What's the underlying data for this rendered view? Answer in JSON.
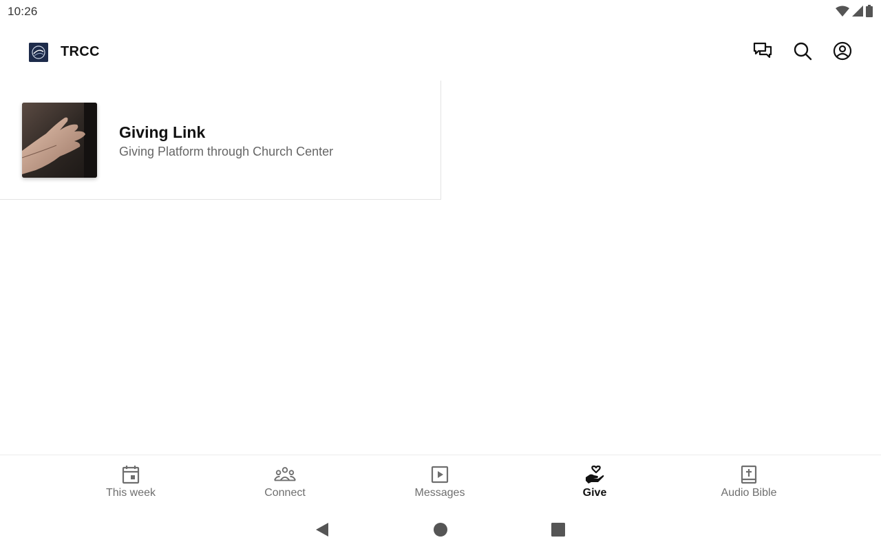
{
  "status_bar": {
    "time": "10:26",
    "icons": [
      "wifi-icon",
      "cell-signal-icon",
      "battery-icon"
    ]
  },
  "app_bar": {
    "title": "TRCC",
    "logo": "church-logo",
    "actions": [
      "chat-icon",
      "search-icon",
      "account-icon"
    ]
  },
  "content": {
    "items": [
      {
        "title": "Giving Link",
        "subtitle": "Giving Platform through Church Center",
        "thumbnail": "open-hand-photo"
      }
    ]
  },
  "bottom_nav": {
    "items": [
      {
        "label": "This week",
        "icon": "calendar-icon",
        "active": false
      },
      {
        "label": "Connect",
        "icon": "group-icon",
        "active": false
      },
      {
        "label": "Messages",
        "icon": "play-video-icon",
        "active": false
      },
      {
        "label": "Give",
        "icon": "giving-hand-heart-icon",
        "active": true
      },
      {
        "label": "Audio Bible",
        "icon": "bible-cross-icon",
        "active": false
      }
    ]
  },
  "system_nav": {
    "buttons": [
      "back-icon",
      "home-icon",
      "recents-icon"
    ]
  },
  "colors": {
    "background": "#ffffff",
    "text_primary": "#111111",
    "text_secondary": "#666666",
    "nav_inactive": "#6e6e6e",
    "logo_bg": "#1d2b4a"
  }
}
